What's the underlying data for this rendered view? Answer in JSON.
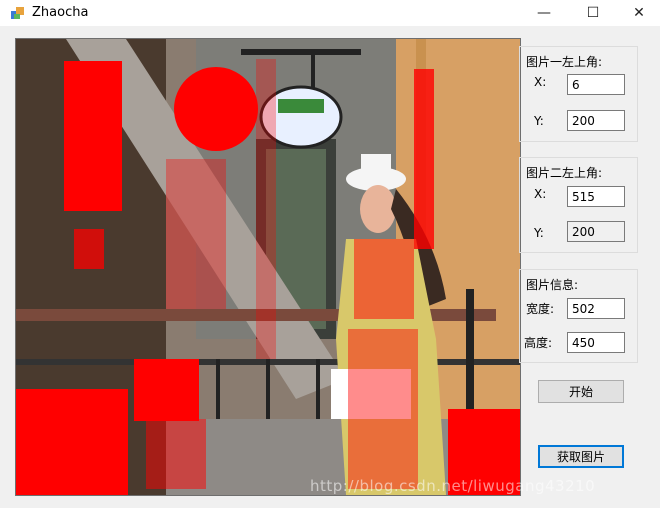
{
  "window": {
    "title": "Zhaocha",
    "minimize_glyph": "—",
    "maximize_glyph": "☐",
    "close_glyph": "✕"
  },
  "group1": {
    "title": "图片一左上角:",
    "x_label": "X:",
    "y_label": "Y:",
    "x_value": "6",
    "y_value": "200"
  },
  "group2": {
    "title": "图片二左上角:",
    "x_label": "X:",
    "y_label": "Y:",
    "x_value": "515",
    "y_value": "200"
  },
  "group3": {
    "title": "图片信息:",
    "width_label": "宽度:",
    "height_label": "高度:",
    "width_value": "502",
    "height_value": "450"
  },
  "buttons": {
    "start": "开始",
    "get_image": "获取图片"
  },
  "watermark": "http://blog.csdn.net/liwugang43210",
  "colors": {
    "highlight": "#ff0000",
    "accent": "#0078d7"
  }
}
